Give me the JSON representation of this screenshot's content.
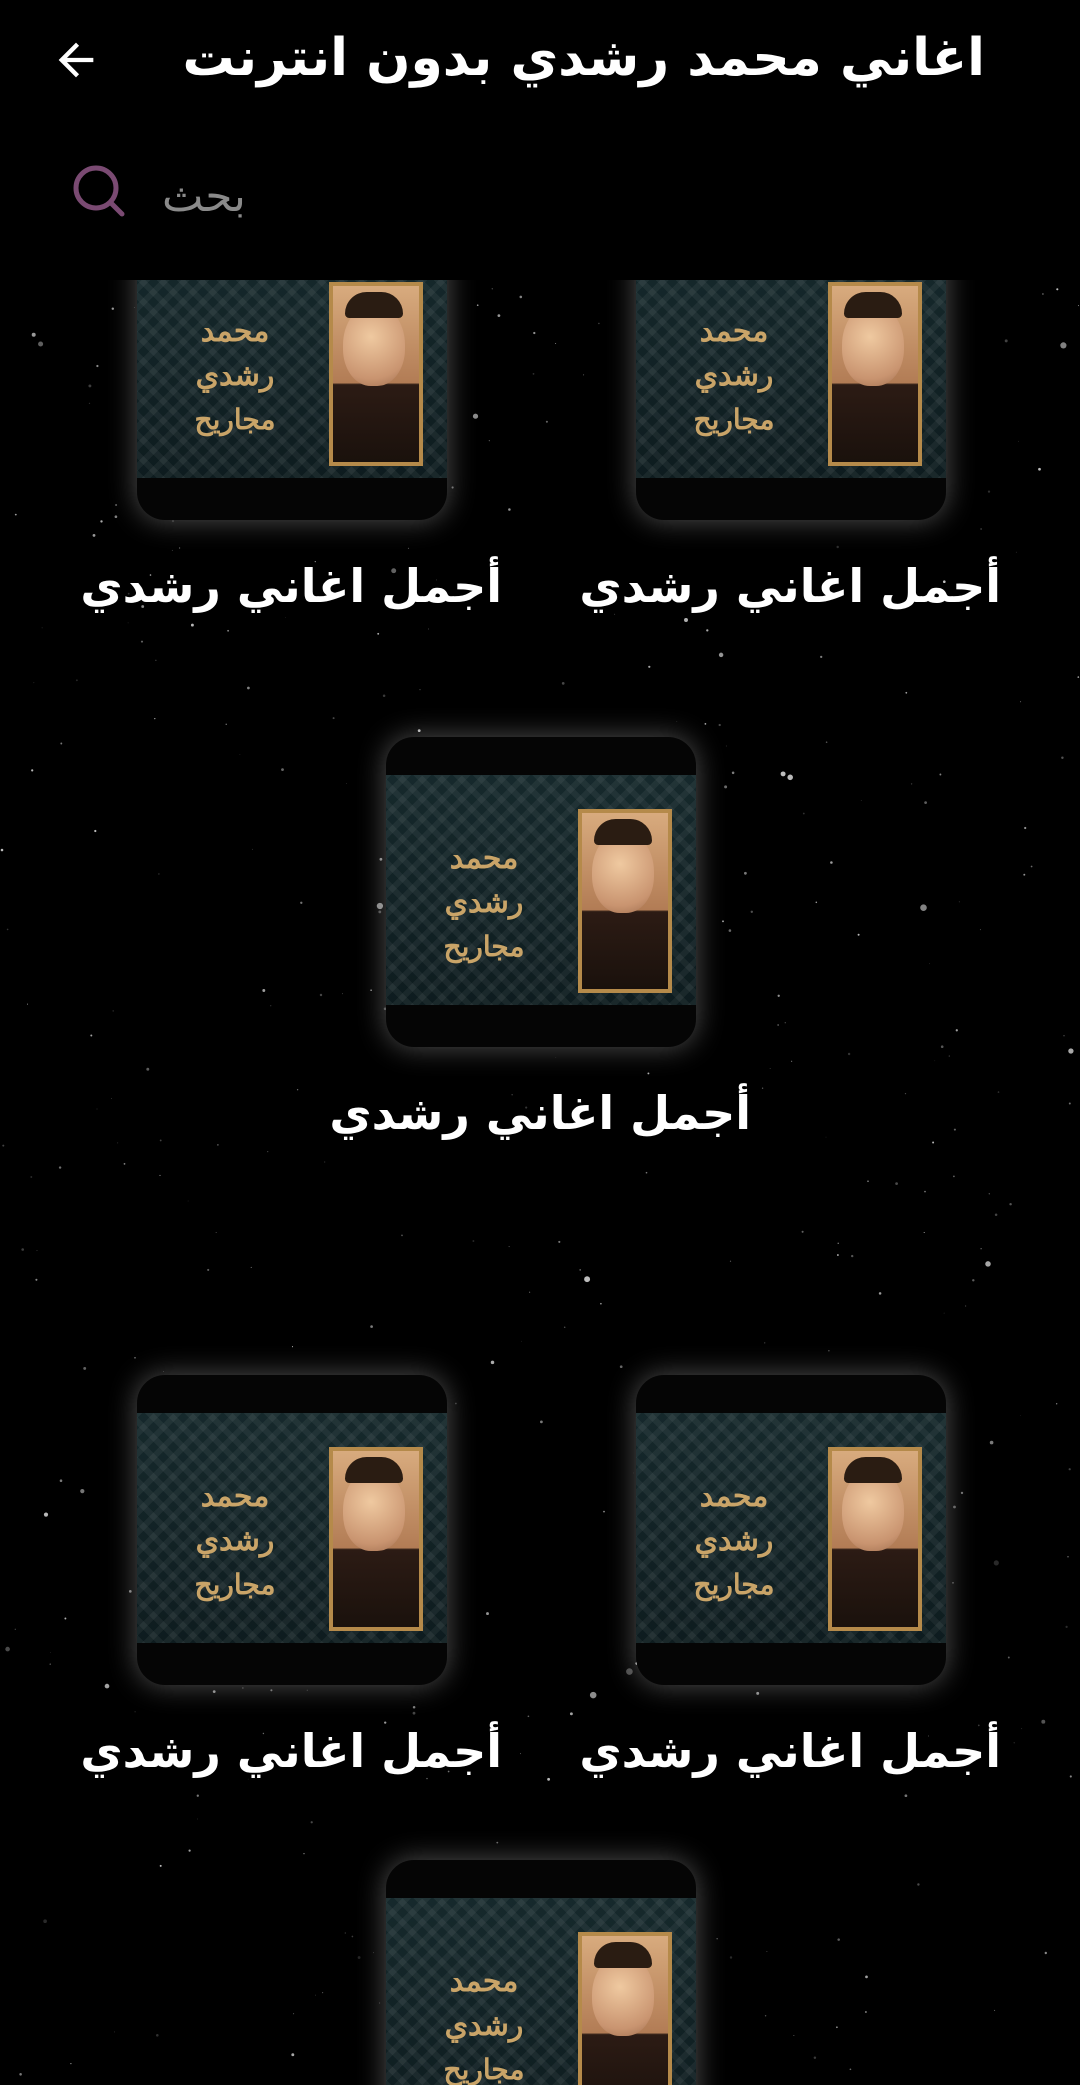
{
  "header": {
    "title": "اغاني محمد رشدي بدون انترنت",
    "back_icon": "arrow-left-icon"
  },
  "search": {
    "placeholder": "بحث",
    "value": "",
    "icon": "search-icon",
    "icon_color": "#7a4a72"
  },
  "album_cover": {
    "line1": "محمد رشدي",
    "line2": "مجاريح"
  },
  "items": [
    {
      "label": "أجمل اغاني رشدي"
    },
    {
      "label": "أجمل اغاني رشدي"
    },
    {
      "label": "أجمل اغاني رشدي"
    },
    {
      "label": "أجمل اغاني رشدي"
    },
    {
      "label": "أجمل اغاني رشدي"
    },
    {
      "label": ""
    }
  ],
  "colors": {
    "background": "#000000",
    "text": "#ffffff",
    "placeholder": "#8a8a8a",
    "gold": "#c9a468"
  }
}
